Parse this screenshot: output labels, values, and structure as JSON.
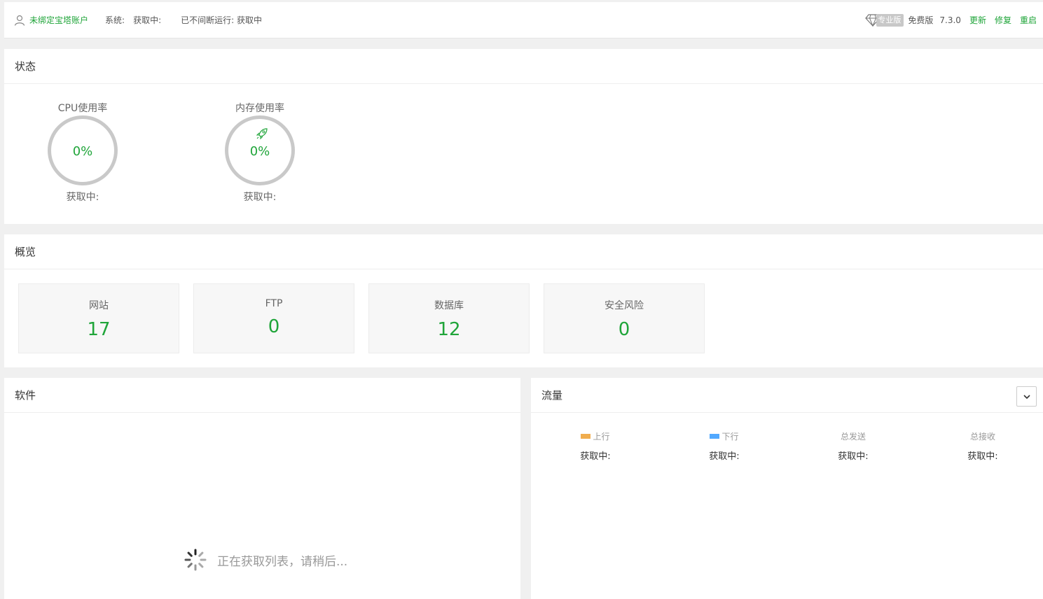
{
  "topbar": {
    "account_label": "未绑定宝塔账户",
    "system_label": "系统:",
    "system_value": "获取中:",
    "uptime_label": "已不间断运行: 获取中",
    "pro_label": "专业版",
    "edition": "免费版",
    "version": "7.3.0",
    "update": "更新",
    "repair": "修复",
    "restart": "重启"
  },
  "status": {
    "title": "状态",
    "cpu": {
      "title": "CPU使用率",
      "value": "0%",
      "footer": "获取中:"
    },
    "memory": {
      "title": "内存使用率",
      "value": "0%",
      "footer": "获取中:"
    }
  },
  "overview": {
    "title": "概览",
    "cards": [
      {
        "label": "网站",
        "value": "17"
      },
      {
        "label": "FTP",
        "value": "0"
      },
      {
        "label": "数据库",
        "value": "12"
      },
      {
        "label": "安全风险",
        "value": "0"
      }
    ]
  },
  "software": {
    "title": "软件",
    "loading_text": "正在获取列表，请稍后..."
  },
  "traffic": {
    "title": "流量",
    "stats": [
      {
        "label": "上行",
        "value": "获取中:",
        "color": "#f0ad4e"
      },
      {
        "label": "下行",
        "value": "获取中:",
        "color": "#52a9ff"
      },
      {
        "label": "总发送",
        "value": "获取中:"
      },
      {
        "label": "总接收",
        "value": "获取中:"
      }
    ]
  },
  "colors": {
    "accent": "#20a53a"
  }
}
